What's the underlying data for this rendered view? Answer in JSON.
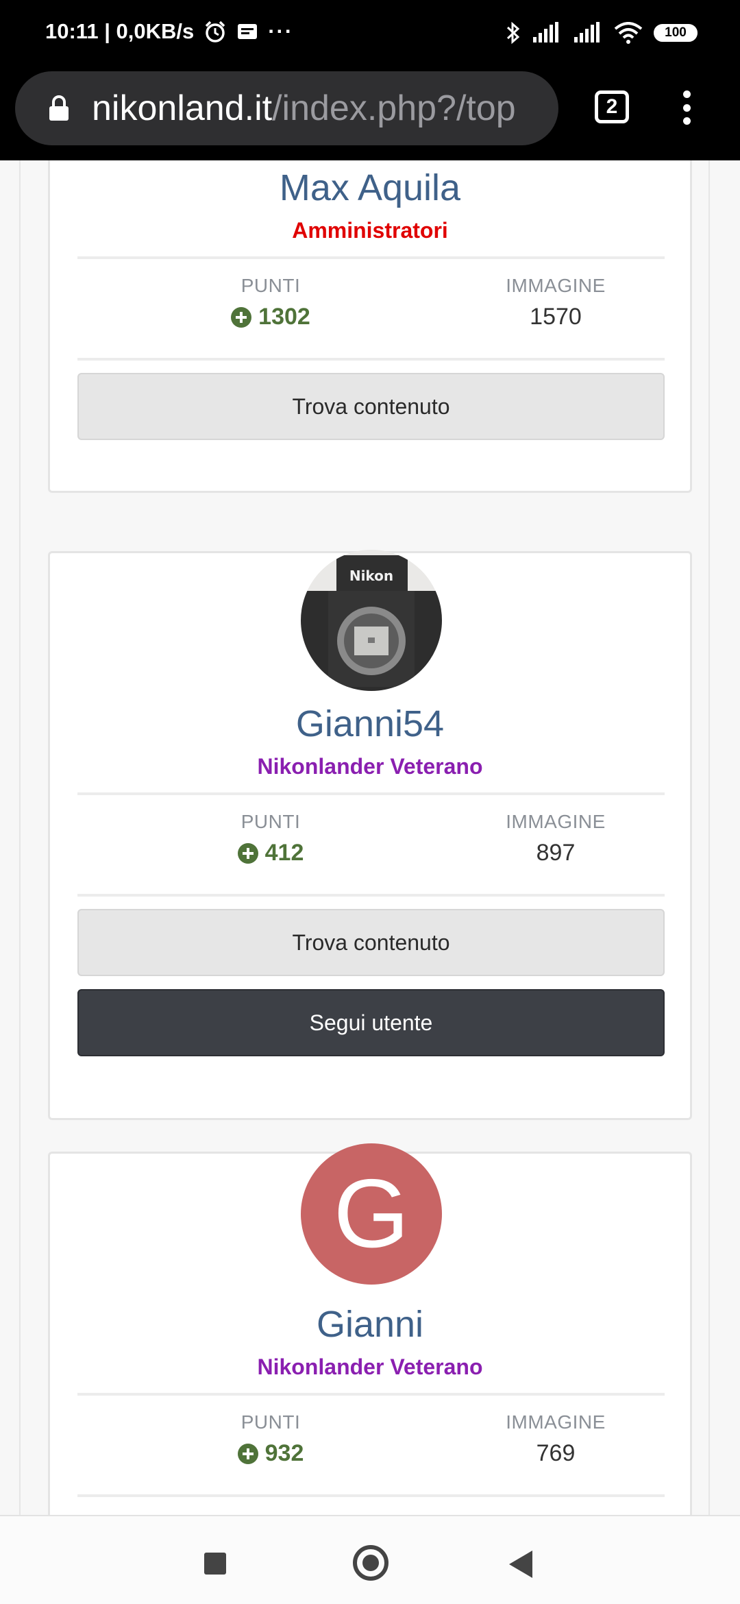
{
  "status_bar": {
    "time_speed": "10:11 | 0,0KB/s",
    "dots": "···",
    "battery": "100"
  },
  "browser": {
    "url_domain": "nikonland.it",
    "url_path": "/index.php?/top",
    "tab_count": "2"
  },
  "members": [
    {
      "name": "Max Aquila",
      "group": "Amministratori",
      "group_color": "#e00000",
      "points_label": "PUNTI",
      "points": "1302",
      "images_label": "IMMAGINE",
      "images": "1570",
      "find_content": "Trova contenuto"
    },
    {
      "name": "Gianni54",
      "group": "Nikonlander Veterano",
      "group_color": "#8a1fb0",
      "avatar_text": "Nikon",
      "points_label": "PUNTI",
      "points": "412",
      "images_label": "IMMAGINE",
      "images": "897",
      "find_content": "Trova contenuto",
      "follow": "Segui utente"
    },
    {
      "name": "Gianni",
      "group": "Nikonlander Veterano",
      "group_color": "#8a1fb0",
      "avatar_letter": "G",
      "avatar_color": "#c86565",
      "points_label": "PUNTI",
      "points": "932",
      "images_label": "IMMAGINE",
      "images": "769"
    }
  ],
  "icons": {
    "alarm": "alarm-icon",
    "notification": "notification-icon",
    "bluetooth": "bluetooth-icon",
    "signal": "signal-icon",
    "wifi": "wifi-icon",
    "lock": "lock-icon",
    "menu": "more-vert-icon",
    "plus": "plus-circle-icon"
  }
}
